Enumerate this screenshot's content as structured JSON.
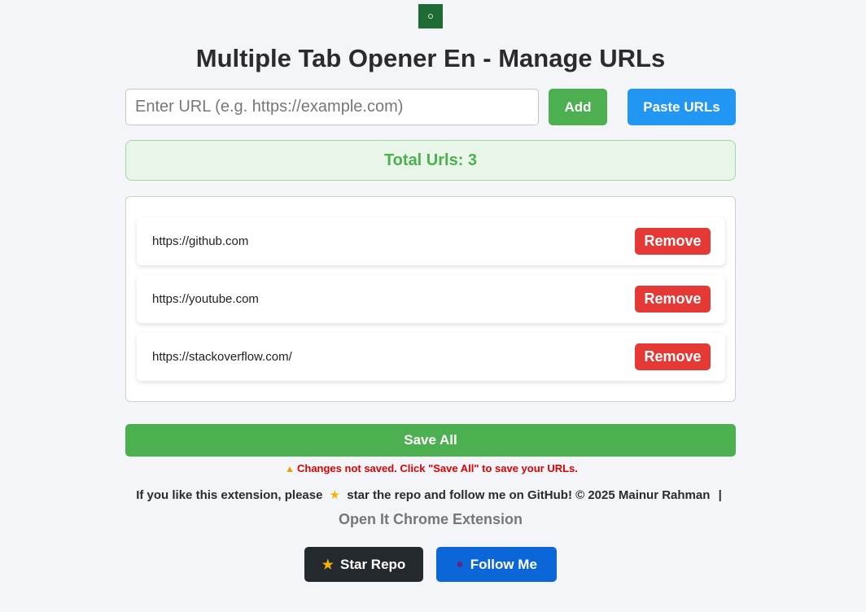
{
  "header": {
    "title": "Multiple Tab Opener En - Manage URLs"
  },
  "input": {
    "placeholder": "Enter URL (e.g. https://example.com)",
    "value": ""
  },
  "buttons": {
    "add_label": "Add",
    "paste_label": "Paste URLs",
    "save_label": "Save All",
    "star_label": "Star Repo",
    "follow_label": "Follow Me"
  },
  "summary": {
    "total_text": "Total Urls: 3"
  },
  "urls": [
    {
      "url": "https://github.com",
      "remove_label": "Remove"
    },
    {
      "url": "https://youtube.com",
      "remove_label": "Remove"
    },
    {
      "url": "https://stackoverflow.com/",
      "remove_label": "Remove"
    }
  ],
  "warning": {
    "icon": "warning-icon",
    "text": "Changes not saved. Click \"Save All\" to save your URLs."
  },
  "footer": {
    "text_before_star": "If you like this extension, please",
    "text_after_star": "star the repo and follow me on GitHub! © 2025 Mainur Rahman",
    "separator": "|",
    "link_text": "Open It Chrome Extension"
  },
  "icons": {
    "logo": "extension-logo",
    "star": "star-icon",
    "person": "person-icon"
  },
  "colors": {
    "success": "#4caf50",
    "primary": "#2196f3",
    "danger": "#e53935",
    "dark": "#24292e",
    "follow": "#0b66d8",
    "warning_text": "#e00000"
  }
}
